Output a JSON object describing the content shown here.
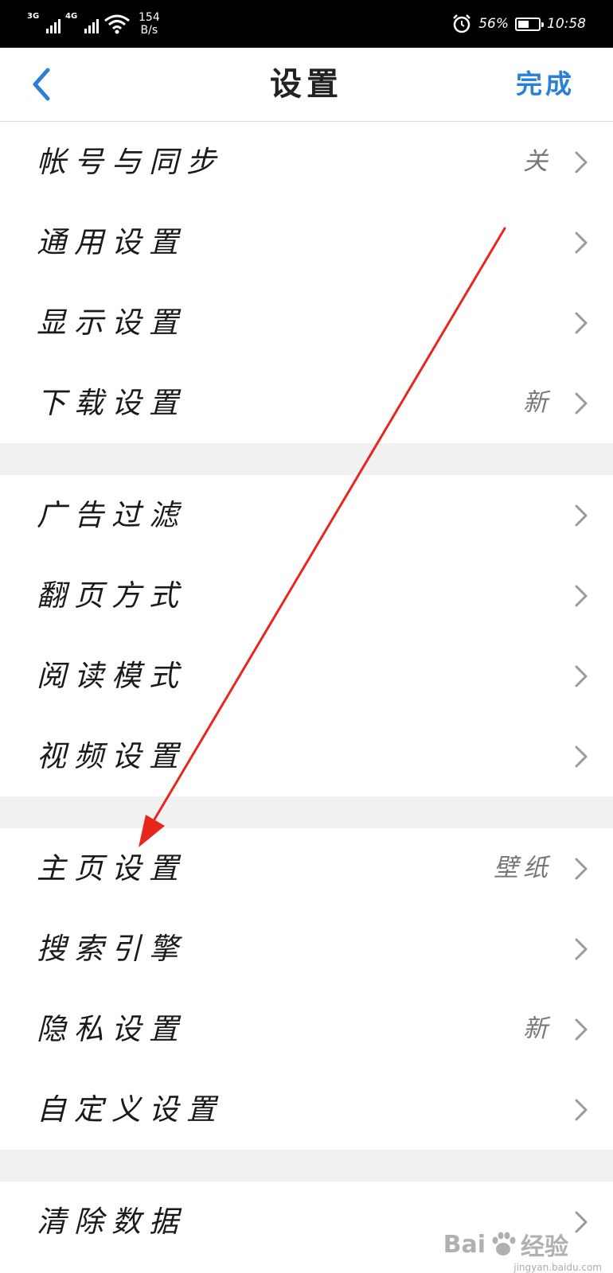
{
  "status_bar": {
    "sim1_type": "3G",
    "sim2_type": "4G",
    "net_speed_value": "154",
    "net_speed_unit": "B/s",
    "battery_percent": "56%",
    "battery_level": 0.56,
    "time": "10:58",
    "icons": [
      "signal-icon",
      "wifi-icon",
      "alarm-icon",
      "battery-icon"
    ]
  },
  "nav": {
    "title": "设置",
    "done_label": "完成",
    "accent_color": "#2a7fd6"
  },
  "groups": [
    {
      "items": [
        {
          "label": "帐号与同步",
          "value": "关"
        },
        {
          "label": "通用设置",
          "value": ""
        },
        {
          "label": "显示设置",
          "value": ""
        },
        {
          "label": "下载设置",
          "value": "新"
        }
      ]
    },
    {
      "items": [
        {
          "label": "广告过滤",
          "value": ""
        },
        {
          "label": "翻页方式",
          "value": ""
        },
        {
          "label": "阅读模式",
          "value": ""
        },
        {
          "label": "视频设置",
          "value": ""
        }
      ]
    },
    {
      "items": [
        {
          "label": "主页设置",
          "value": "壁纸"
        },
        {
          "label": "搜索引擎",
          "value": ""
        },
        {
          "label": "隐私设置",
          "value": "新"
        },
        {
          "label": "自定义设置",
          "value": ""
        }
      ]
    },
    {
      "items": [
        {
          "label": "清除数据",
          "value": ""
        }
      ]
    }
  ],
  "annotation": {
    "color": "#e8261c",
    "icon": "red-arrow-icon"
  },
  "watermark": {
    "brand_latin": "Bai",
    "brand_suffix": "经验",
    "domain": "jingyan.baidu.com"
  }
}
